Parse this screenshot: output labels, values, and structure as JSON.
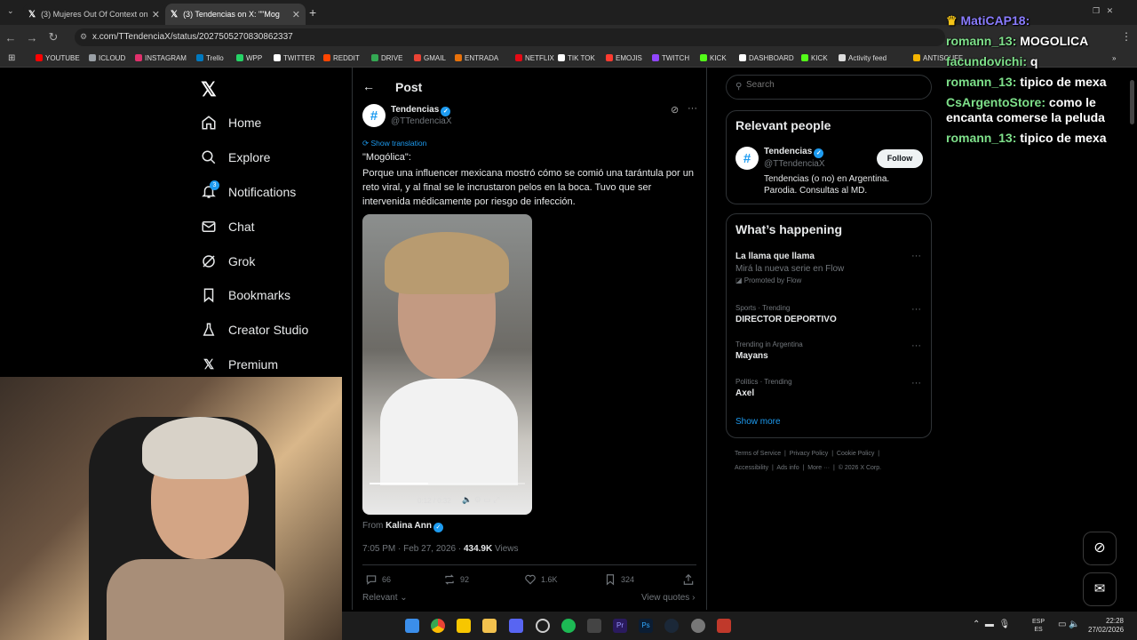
{
  "browser": {
    "tabs": [
      {
        "label": "(3) Mujeres Out Of Context on"
      },
      {
        "label": "(3) Tendencias on X: \"\"Mog"
      }
    ],
    "url": "x.com/TTendenciaX/status/2027505270830862337",
    "bookmarks": [
      "YOUTUBE",
      "ICLOUD",
      "INSTAGRAM",
      "Trello",
      "WPP",
      "TWITTER",
      "REDDIT",
      "DRIVE",
      "GMAIL",
      "ENTRADA",
      "NETFLIX",
      "TIK TOK",
      "EMOJIS",
      "TWITCH",
      "KICK",
      "DASHBOARD",
      "KICK",
      "Activity feed",
      "ANTISCUFF"
    ],
    "bookmark_colors": [
      "#ff0000",
      "#9aa0a6",
      "#e1306c",
      "#0079bf",
      "#25d366",
      "#ffffff",
      "#ff4500",
      "#34a853",
      "#ea4335",
      "#e8710a",
      "#e50914",
      "#ffffff",
      "#ff3b30",
      "#9146ff",
      "#53fc18",
      "#ffffff",
      "#53fc18",
      "#dddddd",
      "#f4b400"
    ]
  },
  "nav": {
    "items": [
      "Home",
      "Explore",
      "Notifications",
      "Chat",
      "Grok",
      "Bookmarks",
      "Creator Studio",
      "Premium"
    ],
    "notification_badge": "3"
  },
  "post": {
    "header_title": "Post",
    "author_name": "Tendencias",
    "author_handle": "@TTendenciaX",
    "show_translation": "Show translation",
    "text_line1": "\"Mogólica\":",
    "text_body": "Porque una influencer mexicana mostró cómo se comió una tarántula por un reto viral, y al final se le incrustaron pelos en la boca. Tuvo que ser intervenida médicamente por riesgo de infección.",
    "video_time": "0:12 / 0:32",
    "video_progress": 0.375,
    "from_label": "From",
    "from_name": "Kalina Ann",
    "timestamp": "7:05 PM · Feb 27, 2026 · ",
    "views_count": "434.9K",
    "views_label": " Views",
    "replies": "66",
    "reposts": "92",
    "likes": "1.6K",
    "bookmarks": "324",
    "sort_label": "Relevant",
    "view_quotes": "View quotes"
  },
  "sidebar": {
    "search_placeholder": "Search",
    "relevant_title": "Relevant people",
    "person_name": "Tendencias",
    "person_handle": "@TTendenciaX",
    "person_bio": "Tendencias (o no) en Argentina. Parodia. Consultas al MD.",
    "follow_label": "Follow",
    "happening_title": "What’s happening",
    "trends": [
      {
        "context": "",
        "title": "La llama que llama",
        "sub": "Mirá la nueva serie en Flow",
        "promo": "Promoted by Flow"
      },
      {
        "context": "Sports · Trending",
        "title": "DIRECTOR DEPORTIVO"
      },
      {
        "context": "Trending in Argentina",
        "title": "Mayans"
      },
      {
        "context": "Politics · Trending",
        "title": "Axel"
      }
    ],
    "show_more": "Show more",
    "footer1": [
      "Terms of Service",
      "Privacy Policy",
      "Cookie Policy"
    ],
    "footer2": [
      "Accessibility",
      "Ads info",
      "More ···",
      "© 2026 X Corp."
    ]
  },
  "stream_chat": [
    {
      "user": "MatiCAP18:",
      "msg": "",
      "color": "#8a7cff"
    },
    {
      "user": "romann_13:",
      "msg": " MOGOLICA",
      "color": "#7ee08a"
    },
    {
      "user": "facundovichi:",
      "msg": " q",
      "color": "#7ee08a"
    },
    {
      "user": "romann_13:",
      "msg": " tipico de mexa",
      "color": "#7ee08a"
    },
    {
      "user": "CsArgentoStore:",
      "msg": " como le",
      "color": "#7ee08a"
    },
    {
      "user": "",
      "msg": "encanta comerse la peluda",
      "color": "#7ee08a"
    },
    {
      "user": "romann_13:",
      "msg": " tipico de mexa",
      "color": "#7ee08a"
    }
  ],
  "taskbar": {
    "lang1": "ESP",
    "lang2": "ES",
    "time": "22:28",
    "date": "27/02/2026"
  }
}
